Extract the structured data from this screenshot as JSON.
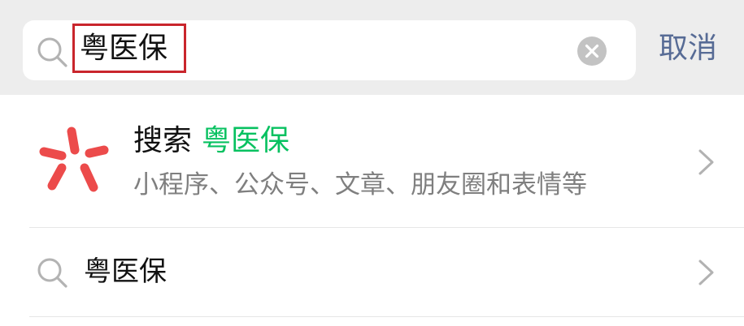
{
  "search": {
    "query": "粤医保",
    "cancel_label": "取消",
    "icon": "search-icon",
    "clear_icon": "clear-icon"
  },
  "result": {
    "title_prefix": "搜索",
    "title_keyword": "粤医保",
    "subtitle": "小程序、公众号、文章、朋友圈和表情等",
    "logo_icon": "red-asterisk-logo",
    "accent_color": "#07c160",
    "logo_color": "#ec4b4b"
  },
  "suggestion": {
    "text": "粤医保",
    "icon": "search-icon"
  },
  "colors": {
    "cancel": "#576b95",
    "highlight_box": "#c9252c",
    "bar_bg": "#ededed"
  }
}
